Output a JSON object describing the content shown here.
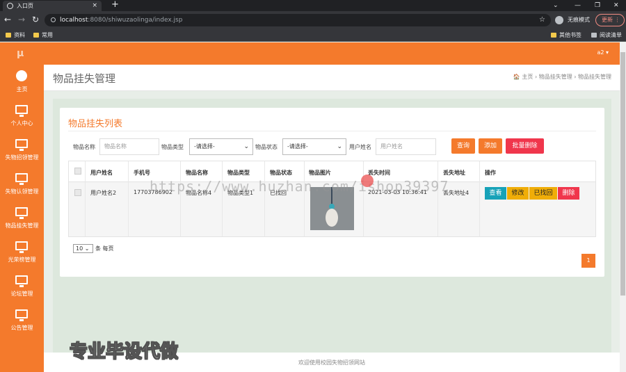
{
  "browser": {
    "tab_title": "入口页",
    "tab_close": "×",
    "new_tab": "+",
    "url_host": "localhost",
    "url_rest": ":8080/shiwuzaolinga/index.jsp",
    "incognito_label": "无痕模式",
    "update_label": "更新",
    "bookmarks": [
      "资料",
      "常用"
    ],
    "bookmarks_right": [
      "其他书签",
      "阅读清单"
    ]
  },
  "app": {
    "logo": "μ",
    "user": "a2 ▾"
  },
  "sidebar": {
    "items": [
      {
        "label": "主页",
        "icon": "dashboard-icon"
      },
      {
        "label": "个人中心",
        "icon": "monitor-icon"
      },
      {
        "label": "失物招领管理",
        "icon": "monitor-icon"
      },
      {
        "label": "失物认领管理",
        "icon": "monitor-icon"
      },
      {
        "label": "物品挂失管理",
        "icon": "monitor-icon"
      },
      {
        "label": "光荣榜管理",
        "icon": "monitor-icon"
      },
      {
        "label": "论坛管理",
        "icon": "monitor-icon"
      },
      {
        "label": "公告管理",
        "icon": "monitor-icon"
      }
    ]
  },
  "page": {
    "title": "物品挂失管理",
    "breadcrumb": "🏠 主页 › 物品挂失管理 › 物品挂失管理"
  },
  "card": {
    "title": "物品挂失列表"
  },
  "filters": {
    "item_name_label": "物品名称",
    "item_name_placeholder": "物品名称",
    "item_type_label": "物品类型",
    "item_type_value": "-请选择-",
    "item_status_label": "物品状态",
    "item_status_value": "-请选择-",
    "user_name_label": "用户姓名",
    "user_name_placeholder": "用户姓名",
    "search": "查询",
    "add": "添加",
    "batch_delete": "批量删除"
  },
  "table": {
    "headers": [
      "用户姓名",
      "手机号",
      "物品名称",
      "物品类型",
      "物品状态",
      "物品图片",
      "丢失时间",
      "丢失地址",
      "操作"
    ],
    "rows": [
      {
        "user": "用户姓名2",
        "phone": "17703786902",
        "item_name": "物品名称4",
        "item_type": "物品类型1",
        "item_status": "已找回",
        "lost_time": "2021-03-03 10:36:41",
        "lost_addr": "丢失地址4",
        "actions": {
          "view": "查看",
          "edit": "修改",
          "found": "已找回",
          "delete": "删除"
        }
      }
    ]
  },
  "pagination": {
    "per_page_value": "10",
    "per_page_suffix": "条 每页",
    "current_page": "1"
  },
  "overlay": {
    "watermark": "https://www.huzhan.com/ishop39397",
    "promo": "专业毕设代做"
  },
  "footer": "欢迎使用校园失物招领网站",
  "colors": {
    "brand": "#f47a2c",
    "danger": "#f0364c",
    "info": "#17a2b8",
    "warning": "#f0ad08"
  }
}
